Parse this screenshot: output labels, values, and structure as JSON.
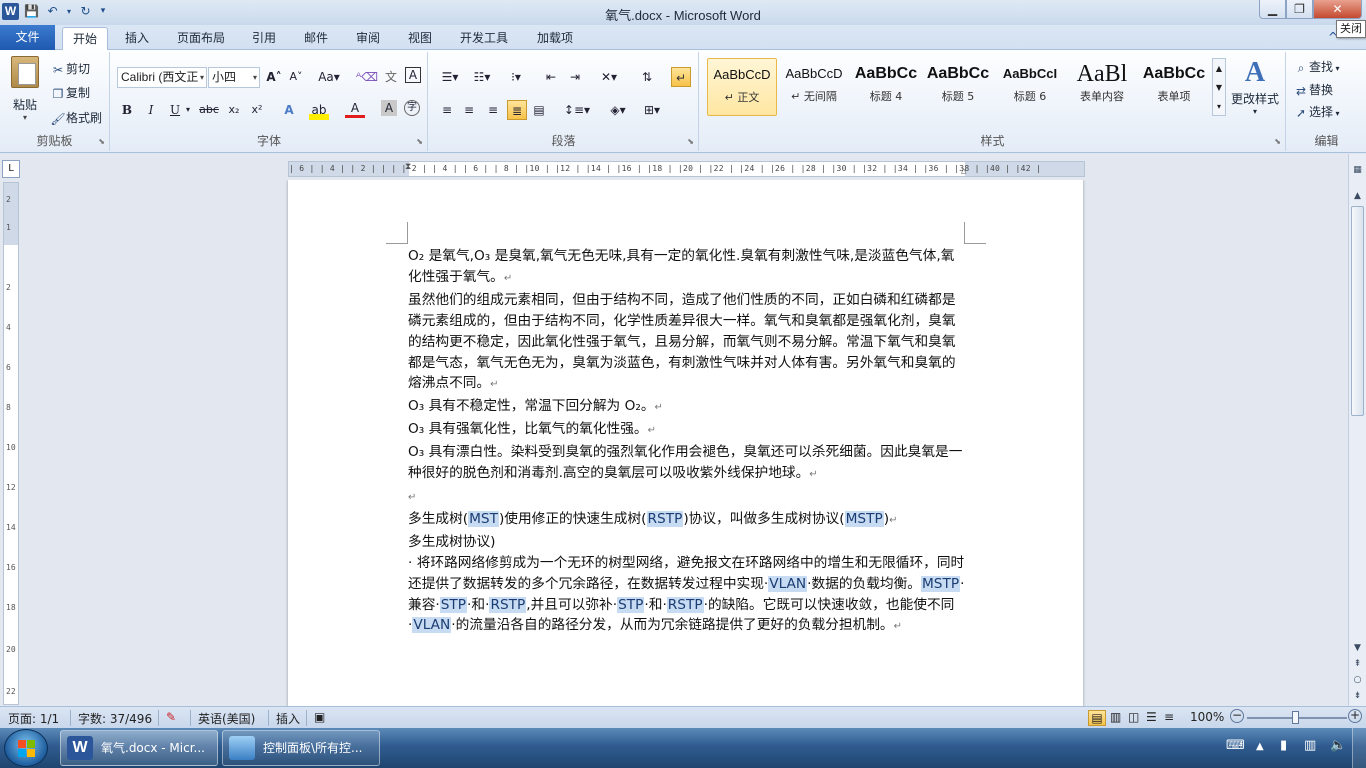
{
  "window": {
    "title": "氧气.docx - Microsoft Word",
    "app_icon": "W",
    "close_tooltip": "关闭",
    "minimize_glyph": "▁",
    "maximize_glyph": "❐",
    "close_glyph": "✕"
  },
  "tabs": {
    "file": "文件",
    "items": [
      "开始",
      "插入",
      "页面布局",
      "引用",
      "邮件",
      "审阅",
      "视图",
      "开发工具",
      "加载项"
    ],
    "active": "开始"
  },
  "ribbon": {
    "clipboard": {
      "label": "剪贴板",
      "paste": "粘贴",
      "cut": "剪切",
      "copy": "复制",
      "format_painter": "格式刷"
    },
    "font": {
      "label": "字体",
      "font_name": "Calibri (西文正",
      "font_size": "小四"
    },
    "paragraph": {
      "label": "段落"
    },
    "styles": {
      "label": "样式",
      "items": [
        {
          "preview": "AaBbCcD",
          "name": "↵ 正文",
          "selected": true
        },
        {
          "preview": "AaBbCcD",
          "name": "↵ 无间隔",
          "selected": false
        },
        {
          "preview": "AaBbCc",
          "name": "标题 4",
          "selected": false
        },
        {
          "preview": "AaBbCc",
          "name": "标题 5",
          "selected": false
        },
        {
          "preview": "AaBbCcI",
          "name": "标题 6",
          "selected": false
        },
        {
          "preview": "AaBl",
          "name": "表单内容",
          "selected": false
        },
        {
          "preview": "AaBbCc",
          "name": "表单项",
          "selected": false
        }
      ],
      "change_styles": "更改样式"
    },
    "editing": {
      "label": "编辑",
      "find": "查找",
      "replace": "替换",
      "select": "选择"
    }
  },
  "ruler": {
    "marks": "| 6 |   | 4 |   | 2 |   |   |   | 2 |   | 4 |   | 6 |   | 8 |   |10 |   |12 |   |14 |   |16 |   |18 |   |20 |   |22 |   |24 |   |26 |   |28 |   |30 |   |32 |   |34 |   |36 |   |38 |   |40 |   |42 |",
    "vertical_numbers": [
      "2",
      "1",
      "2",
      "4",
      "6",
      "8",
      "10",
      "12",
      "14",
      "16",
      "18",
      "20",
      "22"
    ]
  },
  "document": {
    "paragraphs": [
      "O₂ 是氧气,O₃ 是臭氧,氧气无色无味,具有一定的氧化性.臭氧有刺激性气味,是淡蓝色气体,氧化性强于氧气。",
      "虽然他们的组成元素相同，但由于结构不同，造成了他们性质的不同，正如白磷和红磷都是磷元素组成的，但由于结构不同，化学性质差异很大一样。氧气和臭氧都是强氧化剂，臭氧的结构更不稳定，因此氧化性强于氧气，且易分解，而氧气则不易分解。常温下氧气和臭氧都是气态，氧气无色无为，臭氧为淡蓝色，有刺激性气味并对人体有害。另外氧气和臭氧的熔沸点不同。",
      "O₃ 具有不稳定性，常温下回分解为 O₂。",
      "O₃ 具有强氧化性，比氧气的氧化性强。",
      "O₃ 具有漂白性。染料受到臭氧的强烈氧化作用会褪色，臭氧还可以杀死细菌。因此臭氧是一种很好的脱色剂和消毒剂.高空的臭氧层可以吸收紫外线保护地球。",
      ""
    ],
    "mst": {
      "p1_a": "多生成树(",
      "p1_b": "MST",
      "p1_c": ")使用修正的快速生成树(",
      "p1_d": "RSTP",
      "p1_e": ")协议，叫做多生成树协议(",
      "p1_f": "MSTP",
      "p1_g": ")",
      "p2": "多生成树协议)",
      "p3_a": "· 将环路网络修剪成为一个无环的树型网络，避免报文在环路网络中的增生和无限循环，同时还提供了数据转发的多个冗余路径，在数据转发过程中实现·",
      "p3_b": "VLAN",
      "p3_c": "·数据的负载均衡。",
      "p3_d": "MSTP",
      "p3_e": "·兼容·",
      "p3_f": "STP",
      "p3_g": "·和·",
      "p3_h": "RSTP",
      "p3_i": ",并且可以弥补·",
      "p3_j": "STP",
      "p3_k": "·和·",
      "p3_l": "RSTP",
      "p3_m": "·的缺陷。它既可以快速收敛，也能使不同·",
      "p3_n": "VLAN",
      "p3_o": "·的流量沿各自的路径分发，从而为冗余链路提供了更好的负载分担机制。"
    },
    "paragraph_mark": "↵"
  },
  "statusbar": {
    "page": "页面: 1/1",
    "words": "字数: 37/496",
    "language": "英语(美国)",
    "mode": "插入",
    "zoom": "100%",
    "zoom_minus": "−",
    "zoom_plus": "+"
  },
  "taskbar": {
    "items": [
      {
        "label": "氧气.docx - Micr...",
        "active": true
      },
      {
        "label": "控制面板\\所有控...",
        "active": false
      }
    ]
  },
  "colors": {
    "file_tab": "#1f5ab0",
    "highlight": "#c7dcf2",
    "taskbar": "#2f5b8f"
  }
}
